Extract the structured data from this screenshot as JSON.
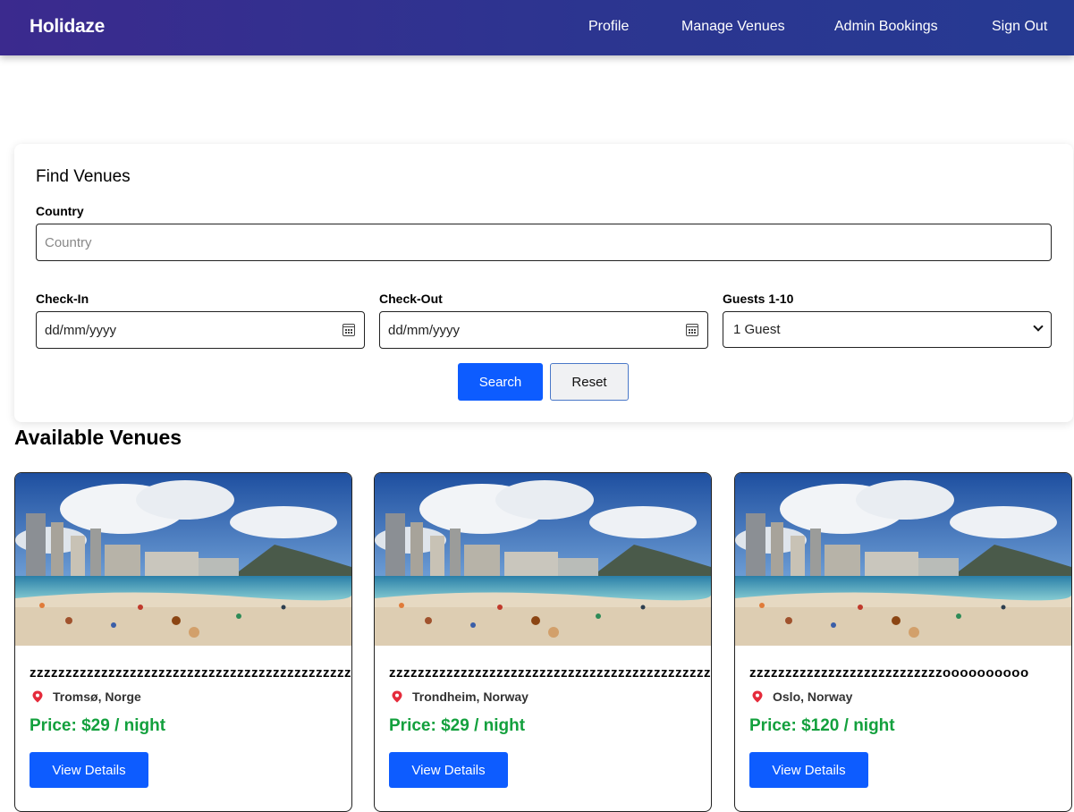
{
  "nav": {
    "brand": "Holidaze",
    "links": [
      "Profile",
      "Manage Venues",
      "Admin Bookings",
      "Sign Out"
    ]
  },
  "search": {
    "title": "Find Venues",
    "country_label": "Country",
    "country_placeholder": "Country",
    "checkin_label": "Check-In",
    "checkin_value": "dd/mm/yyyy",
    "checkout_label": "Check-Out",
    "checkout_value": "dd/mm/yyyy",
    "guests_label": "Guests 1-10",
    "guests_value": "1 Guest",
    "search_button": "Search",
    "reset_button": "Reset"
  },
  "venues_title": "Available Venues",
  "venues": [
    {
      "name": "zzzzzzzzzzzzzzzzzzzzzzzzzzzzzzzzzzzzzzzzzzzzzzzzzzzzzzzz",
      "location": "Tromsø, Norge",
      "price": "Price: $29 / night",
      "button": "View Details",
      "icon": "map-pin-icon",
      "image": "beach-photo"
    },
    {
      "name": "zzzzzzzzzzzzzzzzzzzzzzzzzzzzzzzzzzzzzzzzzzzzzzzzzzzzzzzz",
      "location": "Trondheim, Norway",
      "price": "Price: $29 / night",
      "button": "View Details",
      "icon": "map-pin-icon",
      "image": "beach-photo"
    },
    {
      "name": "zzzzzzzzzzzzzzzzzzzzzzzzzzzoooooooooo",
      "location": "Oslo, Norway",
      "price": "Price: $120 / night",
      "button": "View Details",
      "icon": "map-pin-icon",
      "image": "beach-photo"
    }
  ],
  "colors": {
    "nav_start": "#3b2a8e",
    "nav_end": "#263a92",
    "primary": "#0d5cff",
    "price": "#13a03d",
    "pin": "#e52b3b"
  }
}
